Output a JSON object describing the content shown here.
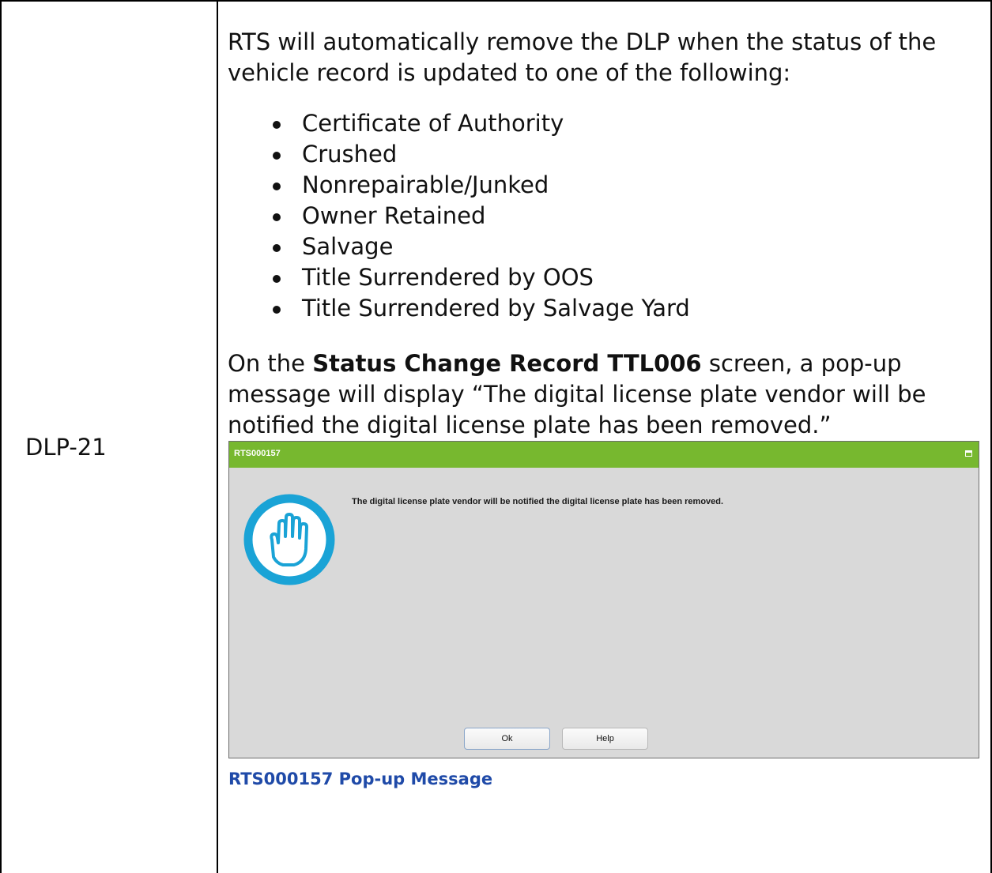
{
  "row_id": "DLP-21",
  "intro": "RTS will automatically remove the DLP when the status of the vehicle record is updated to one of the following:",
  "statuses": [
    "Certificate of Authority",
    "Crushed",
    "Nonrepairable/Junked",
    "Owner Retained",
    "Salvage",
    "Title Surrendered by OOS",
    "Title Surrendered by Salvage Yard"
  ],
  "para": {
    "prefix": "On the ",
    "screen_name": "Status Change Record TTL006",
    "suffix": " screen, a pop-up message will display “The digital license plate vendor will be notified the digital license plate has been removed.”"
  },
  "dialog": {
    "title": "RTS000157",
    "message": "The digital license plate vendor will be notified the digital license plate has been removed.",
    "ok_label": "Ok",
    "help_label": "Help",
    "title_bar_color": "#77b82f",
    "icon": "hand-stop-icon"
  },
  "caption": "RTS000157 Pop-up Message"
}
